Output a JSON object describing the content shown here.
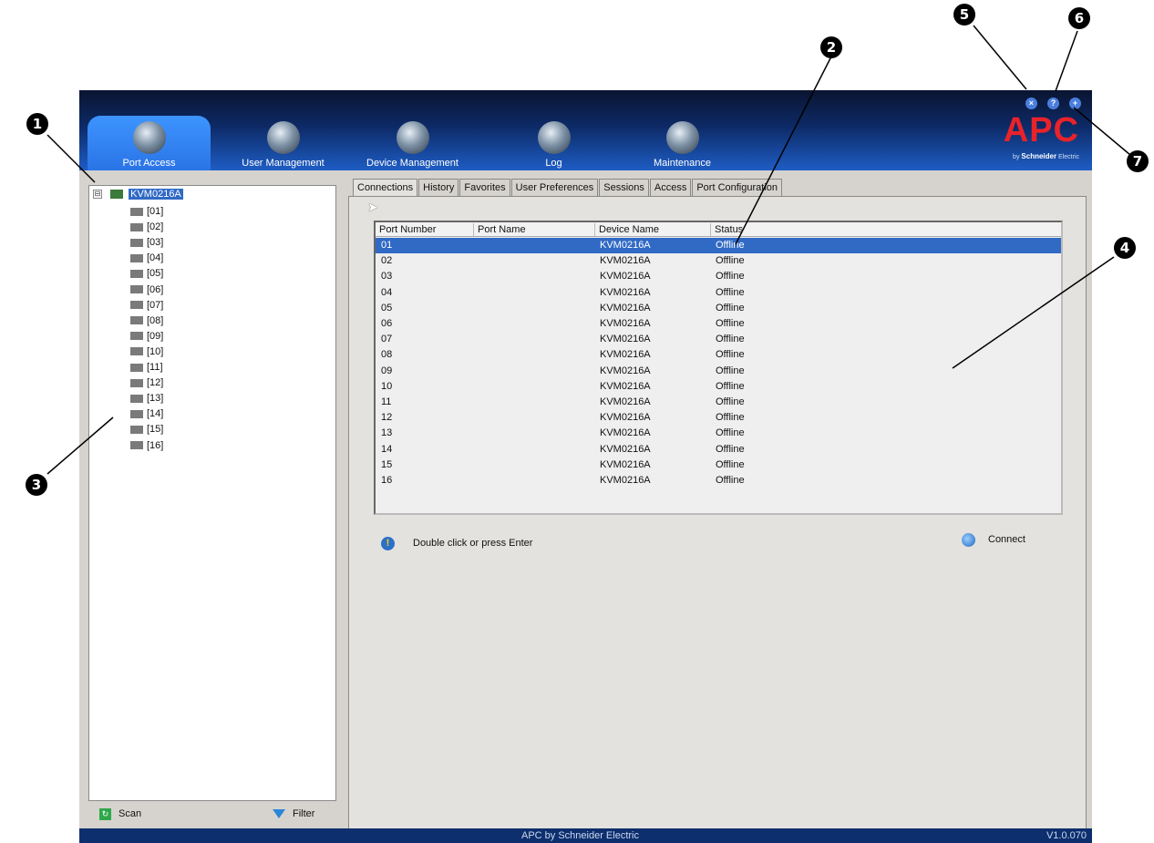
{
  "nav": {
    "tabs": [
      {
        "label": "Port Access",
        "active": true
      },
      {
        "label": "User Management",
        "active": false
      },
      {
        "label": "Device Management",
        "active": false
      },
      {
        "label": "Log",
        "active": false
      },
      {
        "label": "Maintenance",
        "active": false
      }
    ],
    "top_icons": [
      "close-icon",
      "help-icon",
      "info-icon"
    ]
  },
  "logo": {
    "brand": "APC",
    "by": "by",
    "company": "Schneider",
    "company2": "Electric"
  },
  "sidebar": {
    "root": {
      "toggle": "⊟",
      "label": "KVM0216A"
    },
    "ports": [
      "[01]",
      "[02]",
      "[03]",
      "[04]",
      "[05]",
      "[06]",
      "[07]",
      "[08]",
      "[09]",
      "[10]",
      "[11]",
      "[12]",
      "[13]",
      "[14]",
      "[15]",
      "[16]"
    ],
    "scan_label": "Scan",
    "filter_label": "Filter"
  },
  "tabs": [
    "Connections",
    "History",
    "Favorites",
    "User Preferences",
    "Sessions",
    "Access",
    "Port Configuration"
  ],
  "active_tab": "Connections",
  "table": {
    "headers": [
      "Port Number",
      "Port Name",
      "Device Name",
      "Status"
    ],
    "rows": [
      {
        "port": "01",
        "name": "",
        "device": "KVM0216A",
        "status": "Offline"
      },
      {
        "port": "02",
        "name": "",
        "device": "KVM0216A",
        "status": "Offline"
      },
      {
        "port": "03",
        "name": "",
        "device": "KVM0216A",
        "status": "Offline"
      },
      {
        "port": "04",
        "name": "",
        "device": "KVM0216A",
        "status": "Offline"
      },
      {
        "port": "05",
        "name": "",
        "device": "KVM0216A",
        "status": "Offline"
      },
      {
        "port": "06",
        "name": "",
        "device": "KVM0216A",
        "status": "Offline"
      },
      {
        "port": "07",
        "name": "",
        "device": "KVM0216A",
        "status": "Offline"
      },
      {
        "port": "08",
        "name": "",
        "device": "KVM0216A",
        "status": "Offline"
      },
      {
        "port": "09",
        "name": "",
        "device": "KVM0216A",
        "status": "Offline"
      },
      {
        "port": "10",
        "name": "",
        "device": "KVM0216A",
        "status": "Offline"
      },
      {
        "port": "11",
        "name": "",
        "device": "KVM0216A",
        "status": "Offline"
      },
      {
        "port": "12",
        "name": "",
        "device": "KVM0216A",
        "status": "Offline"
      },
      {
        "port": "13",
        "name": "",
        "device": "KVM0216A",
        "status": "Offline"
      },
      {
        "port": "14",
        "name": "",
        "device": "KVM0216A",
        "status": "Offline"
      },
      {
        "port": "15",
        "name": "",
        "device": "KVM0216A",
        "status": "Offline"
      },
      {
        "port": "16",
        "name": "",
        "device": "KVM0216A",
        "status": "Offline"
      }
    ],
    "selected_row": 0
  },
  "hint": "Double click or press Enter",
  "connect_label": "Connect",
  "footer": {
    "center": "APC by Schneider Electric",
    "version": "V1.0.070"
  },
  "callouts": [
    "1",
    "2",
    "3",
    "4",
    "5",
    "6",
    "7"
  ],
  "colors": {
    "selection": "#316ac5",
    "header_bg": "#1e5dc5",
    "brand": "#e8232a"
  }
}
